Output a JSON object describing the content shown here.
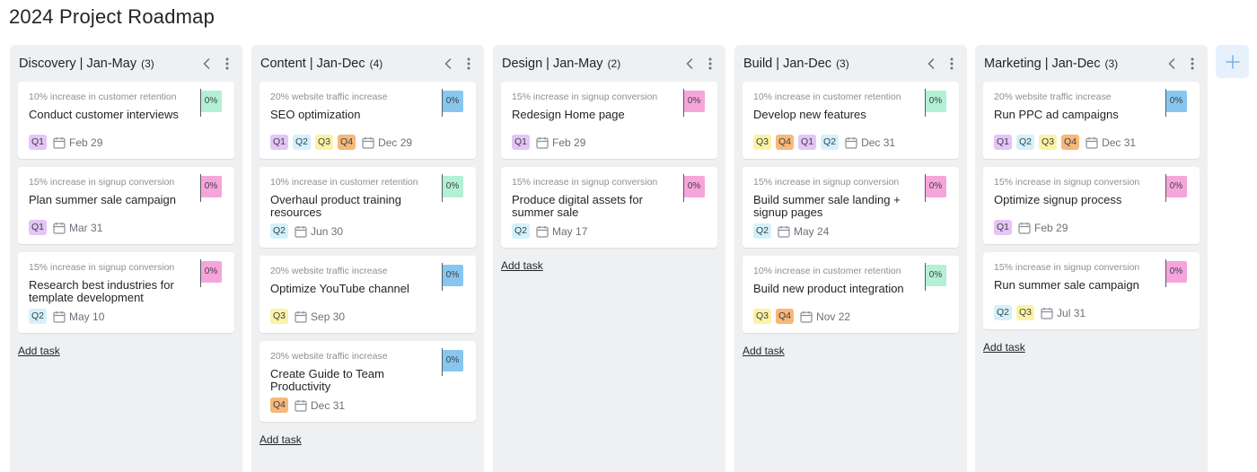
{
  "page_title": "2024 Project Roadmap",
  "add_task_label": "Add task",
  "colors": {
    "Q1": "#e5c4f7",
    "Q2": "#d4f1fb",
    "Q3": "#fcf2a6",
    "Q4": "#f7b879",
    "green": "#b4f0d4",
    "blue": "#87c7ef",
    "pink": "#f6a5dc"
  },
  "columns": [
    {
      "title": "Discovery | Jan-May",
      "count": "(3)",
      "cards": [
        {
          "goal": "10% increase in customer retention",
          "title": "Conduct customer interviews",
          "progress": "0%",
          "progress_color": "green",
          "quarters": [
            "Q1"
          ],
          "date": "Feb 29",
          "lines": 1
        },
        {
          "goal": "15% increase in signup conversion",
          "title": "Plan summer sale campaign",
          "progress": "0%",
          "progress_color": "pink",
          "quarters": [
            "Q1"
          ],
          "date": "Mar 31",
          "lines": 1
        },
        {
          "goal": "15% increase in signup conversion",
          "title": "Research best industries for template development",
          "progress": "0%",
          "progress_color": "pink",
          "quarters": [
            "Q2"
          ],
          "date": "May 10",
          "lines": 2
        }
      ]
    },
    {
      "title": "Content | Jan-Dec",
      "count": "(4)",
      "cards": [
        {
          "goal": "20% website traffic increase",
          "title": "SEO optimization",
          "progress": "0%",
          "progress_color": "blue",
          "quarters": [
            "Q1",
            "Q2",
            "Q3",
            "Q4"
          ],
          "date": "Dec 29",
          "lines": 1
        },
        {
          "goal": "10% increase in customer retention",
          "title": "Overhaul product training resources",
          "progress": "0%",
          "progress_color": "green",
          "quarters": [
            "Q2"
          ],
          "date": "Jun 30",
          "lines": 2
        },
        {
          "goal": "20% website traffic increase",
          "title": "Optimize YouTube channel",
          "progress": "0%",
          "progress_color": "blue",
          "quarters": [
            "Q3"
          ],
          "date": "Sep 30",
          "lines": 1
        },
        {
          "goal": "20% website traffic increase",
          "title": "Create Guide to Team Productivity",
          "progress": "0%",
          "progress_color": "blue",
          "quarters": [
            "Q4"
          ],
          "date": "Dec 31",
          "lines": 2
        }
      ]
    },
    {
      "title": "Design | Jan-May",
      "count": "(2)",
      "cards": [
        {
          "goal": "15% increase in signup conversion",
          "title": "Redesign Home page",
          "progress": "0%",
          "progress_color": "pink",
          "quarters": [
            "Q1"
          ],
          "date": "Feb 29",
          "lines": 1
        },
        {
          "goal": "15% increase in signup conversion",
          "title": "Produce digital assets for summer sale",
          "progress": "0%",
          "progress_color": "pink",
          "quarters": [
            "Q2"
          ],
          "date": "May 17",
          "lines": 2
        }
      ]
    },
    {
      "title": "Build | Jan-Dec",
      "count": "(3)",
      "cards": [
        {
          "goal": "10% increase in customer retention",
          "title": "Develop new features",
          "progress": "0%",
          "progress_color": "green",
          "quarters": [
            "Q3",
            "Q4",
            "Q1",
            "Q2"
          ],
          "date": "Dec 31",
          "lines": 1
        },
        {
          "goal": "15% increase in signup conversion",
          "title": "Build summer sale landing + signup pages",
          "progress": "0%",
          "progress_color": "pink",
          "quarters": [
            "Q2"
          ],
          "date": "May 24",
          "lines": 2
        },
        {
          "goal": "10% increase in customer retention",
          "title": "Build new product integration",
          "progress": "0%",
          "progress_color": "green",
          "quarters": [
            "Q3",
            "Q4"
          ],
          "date": "Nov 22",
          "lines": 1
        }
      ]
    },
    {
      "title": "Marketing | Jan-Dec",
      "count": "(3)",
      "cards": [
        {
          "goal": "20% website traffic increase",
          "title": "Run PPC ad campaigns",
          "progress": "0%",
          "progress_color": "blue",
          "quarters": [
            "Q1",
            "Q2",
            "Q3",
            "Q4"
          ],
          "date": "Dec 31",
          "lines": 1
        },
        {
          "goal": "15% increase in signup conversion",
          "title": "Optimize signup process",
          "progress": "0%",
          "progress_color": "pink",
          "quarters": [
            "Q1"
          ],
          "date": "Feb 29",
          "lines": 1
        },
        {
          "goal": "15% increase in signup conversion",
          "title": "Run summer sale campaign",
          "progress": "0%",
          "progress_color": "pink",
          "quarters": [
            "Q2",
            "Q3"
          ],
          "date": "Jul 31",
          "lines": 1
        }
      ]
    }
  ]
}
